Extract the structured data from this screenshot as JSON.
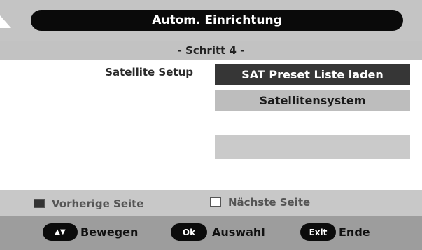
{
  "header": {
    "title": "Autom. Einrichtung"
  },
  "step": {
    "label": "- Schritt 4 -"
  },
  "setup": {
    "label": "Satellite Setup"
  },
  "menu": {
    "items": [
      {
        "label": "SAT Preset Liste laden",
        "state": "selected"
      },
      {
        "label": "Satellitensystem",
        "state": "normal"
      },
      {
        "label": "",
        "state": "empty"
      }
    ]
  },
  "page_nav": {
    "previous": {
      "label": "Vorherige Seite",
      "swatch_color": "#333333"
    },
    "next": {
      "label": "Nächste Seite",
      "swatch_color": "#ffffff"
    }
  },
  "help": {
    "move": {
      "key": "▲▼",
      "label": "Bewegen"
    },
    "ok": {
      "key": "Ok",
      "label": "Auswahl"
    },
    "exit": {
      "key": "Exit",
      "label": "Ende"
    }
  },
  "colors": {
    "header_bg": "#0a0a0a",
    "selected_row": "#363636",
    "row": "#bdbdbd",
    "help_bar": "#9d9d9d"
  }
}
